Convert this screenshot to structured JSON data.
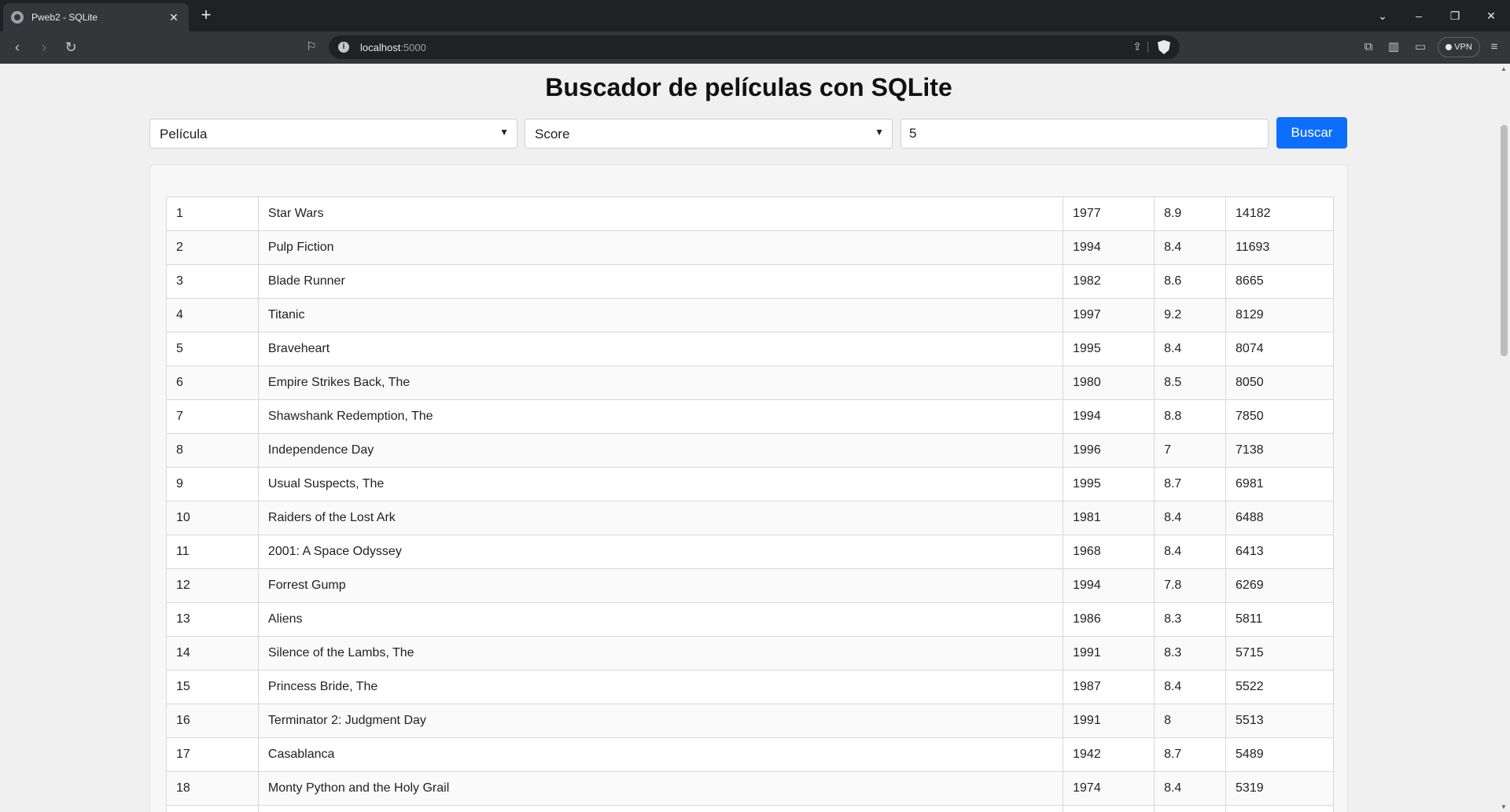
{
  "browser": {
    "tab_title": "Pweb2 - SQLite",
    "url_host": "localhost",
    "url_port": ":5000",
    "vpn_label": "VPN"
  },
  "page": {
    "title": "Buscador de películas con SQLite",
    "field_select": "Película",
    "order_select": "Score",
    "query_value": "5",
    "search_button": "Buscar"
  },
  "results": [
    {
      "idx": "1",
      "title": "Star Wars",
      "year": "1977",
      "score": "8.9",
      "votes": "14182"
    },
    {
      "idx": "2",
      "title": "Pulp Fiction",
      "year": "1994",
      "score": "8.4",
      "votes": "11693"
    },
    {
      "idx": "3",
      "title": "Blade Runner",
      "year": "1982",
      "score": "8.6",
      "votes": "8665"
    },
    {
      "idx": "4",
      "title": "Titanic",
      "year": "1997",
      "score": "9.2",
      "votes": "8129"
    },
    {
      "idx": "5",
      "title": "Braveheart",
      "year": "1995",
      "score": "8.4",
      "votes": "8074"
    },
    {
      "idx": "6",
      "title": "Empire Strikes Back, The",
      "year": "1980",
      "score": "8.5",
      "votes": "8050"
    },
    {
      "idx": "7",
      "title": "Shawshank Redemption, The",
      "year": "1994",
      "score": "8.8",
      "votes": "7850"
    },
    {
      "idx": "8",
      "title": "Independence Day",
      "year": "1996",
      "score": "7",
      "votes": "7138"
    },
    {
      "idx": "9",
      "title": "Usual Suspects, The",
      "year": "1995",
      "score": "8.7",
      "votes": "6981"
    },
    {
      "idx": "10",
      "title": "Raiders of the Lost Ark",
      "year": "1981",
      "score": "8.4",
      "votes": "6488"
    },
    {
      "idx": "11",
      "title": "2001: A Space Odyssey",
      "year": "1968",
      "score": "8.4",
      "votes": "6413"
    },
    {
      "idx": "12",
      "title": "Forrest Gump",
      "year": "1994",
      "score": "7.8",
      "votes": "6269"
    },
    {
      "idx": "13",
      "title": "Aliens",
      "year": "1986",
      "score": "8.3",
      "votes": "5811"
    },
    {
      "idx": "14",
      "title": "Silence of the Lambs, The",
      "year": "1991",
      "score": "8.3",
      "votes": "5715"
    },
    {
      "idx": "15",
      "title": "Princess Bride, The",
      "year": "1987",
      "score": "8.4",
      "votes": "5522"
    },
    {
      "idx": "16",
      "title": "Terminator 2: Judgment Day",
      "year": "1991",
      "score": "8",
      "votes": "5513"
    },
    {
      "idx": "17",
      "title": "Casablanca",
      "year": "1942",
      "score": "8.7",
      "votes": "5489"
    },
    {
      "idx": "18",
      "title": "Monty Python and the Holy Grail",
      "year": "1974",
      "score": "8.4",
      "votes": "5319"
    },
    {
      "idx": "",
      "title": "",
      "year": "",
      "score": "",
      "votes": ""
    }
  ]
}
